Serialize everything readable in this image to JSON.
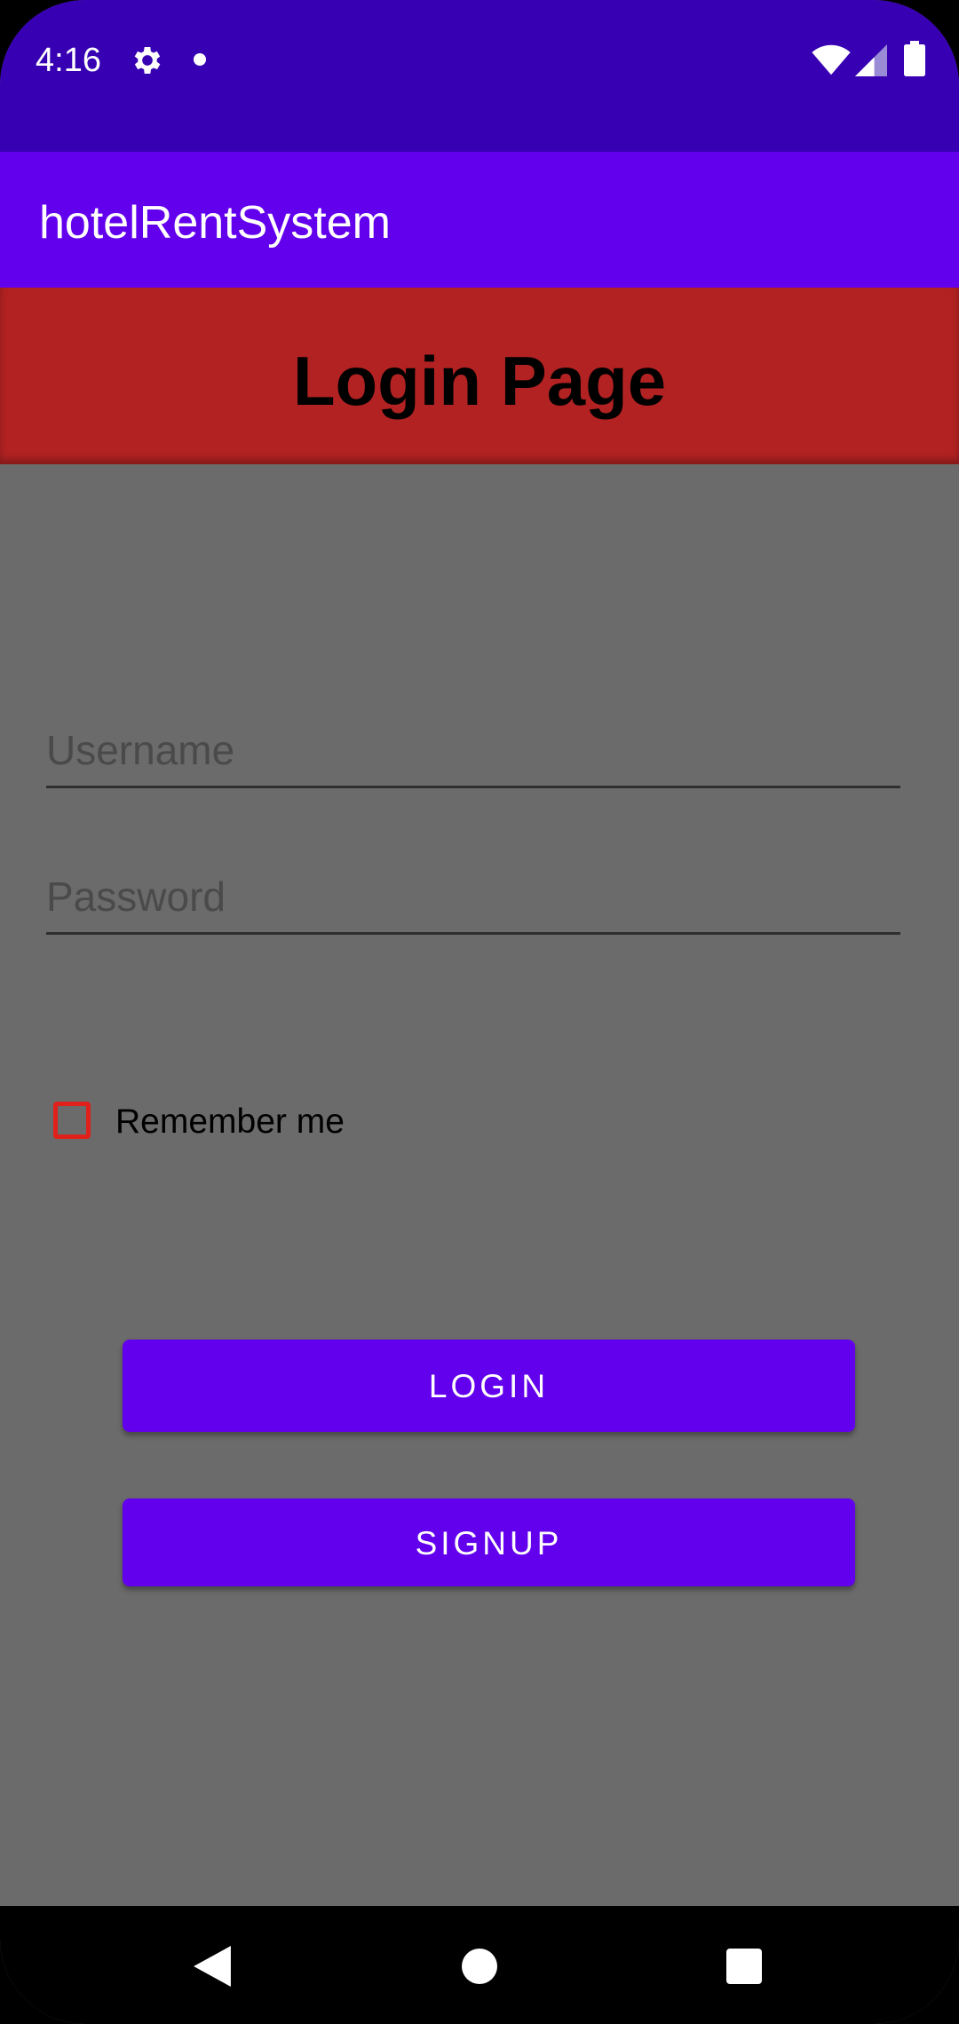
{
  "status_bar": {
    "time": "4:16",
    "icons": [
      "gear-icon",
      "notification-dot-icon",
      "wifi-icon",
      "signal-icon",
      "battery-icon"
    ],
    "background_color": "#3700b3"
  },
  "app_bar": {
    "title": "hotelRentSystem",
    "background_color": "#6200ee"
  },
  "header": {
    "title": "Login Page",
    "background_color": "#b22222"
  },
  "form": {
    "username": {
      "placeholder": "Username",
      "value": ""
    },
    "password": {
      "placeholder": "Password",
      "value": ""
    },
    "remember_me": {
      "label": "Remember me",
      "checked": false
    },
    "background_color": "#6b6b6b"
  },
  "buttons": {
    "login_label": "LOGIN",
    "signup_label": "SIGNUP",
    "color": "#6200ee"
  },
  "nav_bar": {
    "icons": [
      "back-icon",
      "home-icon",
      "recents-icon"
    ]
  }
}
